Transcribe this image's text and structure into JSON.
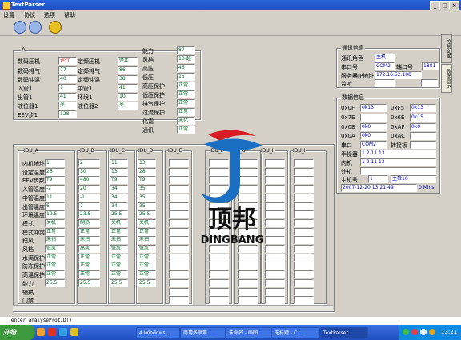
{
  "window": {
    "title": "TextParser"
  },
  "menu": [
    "设置",
    "协议",
    "选项",
    "帮助"
  ],
  "top_panel": {
    "group_label": "A",
    "col1": [
      {
        "label": "数码压机",
        "value": "运行"
      },
      {
        "label": "数码排气",
        "value": "77"
      },
      {
        "label": "数码油温",
        "value": "40"
      },
      {
        "label": "入管1",
        "value": "1"
      },
      {
        "label": "出管1",
        "value": "41"
      },
      {
        "label": "液位器1",
        "value": "关"
      },
      {
        "label": "EEV步1",
        "value": "128"
      }
    ],
    "col2": [
      {
        "label": "定频压机",
        "value": "停止"
      },
      {
        "label": "定频排气",
        "value": "86"
      },
      {
        "label": "定频油温",
        "value": "38"
      },
      {
        "label": "中管1",
        "value": "41"
      },
      {
        "label": "环境1",
        "value": "10"
      },
      {
        "label": "液位器2",
        "value": "关"
      }
    ],
    "col3": [
      {
        "label": "能力",
        "value": "87"
      },
      {
        "label": "风档",
        "value": "10-超"
      },
      {
        "label": "高压",
        "value": "46"
      },
      {
        "label": "低压",
        "value": "15"
      },
      {
        "label": "高压保护",
        "value": "正常"
      },
      {
        "label": "低压保护",
        "value": "正常"
      },
      {
        "label": "排气保护",
        "value": "正常"
      },
      {
        "label": "过流保护",
        "value": "正常"
      },
      {
        "label": "化霜",
        "value": "未化"
      },
      {
        "label": "通讯",
        "value": "正常"
      }
    ]
  },
  "comm_panel": {
    "title": "通讯信息",
    "role_label": "通讯角色",
    "role_value": "主机",
    "port_label": "串口号",
    "port_value": "COM2",
    "port_num_label": "端口号",
    "port_num_value": "1881",
    "ip_label": "服务器IP地址",
    "ip_value": "172.16.52.108",
    "listen_label": "监听"
  },
  "data_panel": {
    "title": "数据信息",
    "rows": [
      {
        "l1": "0x0F",
        "v1": "0k13",
        "l2": "0xF5",
        "v2": "0k13"
      },
      {
        "l1": "0x7E",
        "v1": "",
        "l2": "0x6E",
        "v2": "0k15"
      },
      {
        "l1": "0x0B",
        "v1": "0k0",
        "l2": "0xAF",
        "v2": "0k0"
      },
      {
        "l1": "0x0A",
        "v1": "0k0",
        "l2": "0xAC",
        "v2": ""
      }
    ],
    "serial_label": "串口",
    "serial_value": "COM2",
    "convert_label": "转接板",
    "operator_label": "手操器",
    "operator_value": "1 2 11 13",
    "inner_label": "内机",
    "inner_value": "1 2 11 13",
    "outer_label": "外机",
    "host_label": "主机号",
    "host_value": "1",
    "detect_value": "主检16",
    "timestamp": "2007-12-20 13:21:49",
    "duration": "0 Mins"
  },
  "side_tabs": [
    "控制文本",
    "数据显示"
  ],
  "idu_table": {
    "columns": [
      "IDU_A",
      "IDU_B",
      "IDU_C",
      "IDU_D",
      "IDU_E",
      "IDU_F",
      "IDU_G",
      "IDU_H",
      "IDU_I"
    ],
    "row_labels": [
      "内机地址",
      "设定温度",
      "EEV步数",
      "入管温度",
      "中管温度",
      "出管温度",
      "环境温度",
      "模式",
      "模式冲突",
      "扫风",
      "风档",
      "水满保护",
      "防冻保护",
      "高温保护",
      "能力",
      "辅热",
      "门禁"
    ],
    "col_values": [
      [
        "1",
        "26",
        "T9",
        "-2",
        "11",
        "6",
        "19.5",
        "关机",
        "正常",
        "未扫",
        "低风",
        "正常",
        "正常",
        "正常",
        "25.5"
      ],
      [
        "2",
        "30",
        "480",
        "20",
        "-1",
        "7",
        "23.5",
        "制热",
        "正常",
        "未扫",
        "高风",
        "正常",
        "正常",
        "正常",
        "25.5"
      ],
      [
        "11",
        "13",
        "T9",
        "34",
        "34",
        "34",
        "25.5",
        "关机",
        "正常",
        "未扫",
        "低风",
        "正常",
        "正常",
        "正常",
        "25.5"
      ],
      [
        "13",
        "28",
        "T9",
        "35",
        "35",
        "35",
        "25.5",
        "关机",
        "正常",
        "未扫",
        "低风",
        "正常",
        "正常",
        "正常",
        "25.5"
      ]
    ]
  },
  "logo": {
    "name": "顶邦",
    "latin": "DINGBANG"
  },
  "status_line": "enter analyseProtID()",
  "taskbar": {
    "start": "开始",
    "tasks": [
      "4 Windows...",
      "商用多联第...",
      "未命名 - 画图",
      "无标题 - C...",
      "TextParser"
    ],
    "clock": "13:21"
  },
  "colors": {
    "title": "#2a63d8",
    "value_green": "#006b28",
    "value_red": "#dd0000",
    "value_blue": "#0000c0"
  }
}
